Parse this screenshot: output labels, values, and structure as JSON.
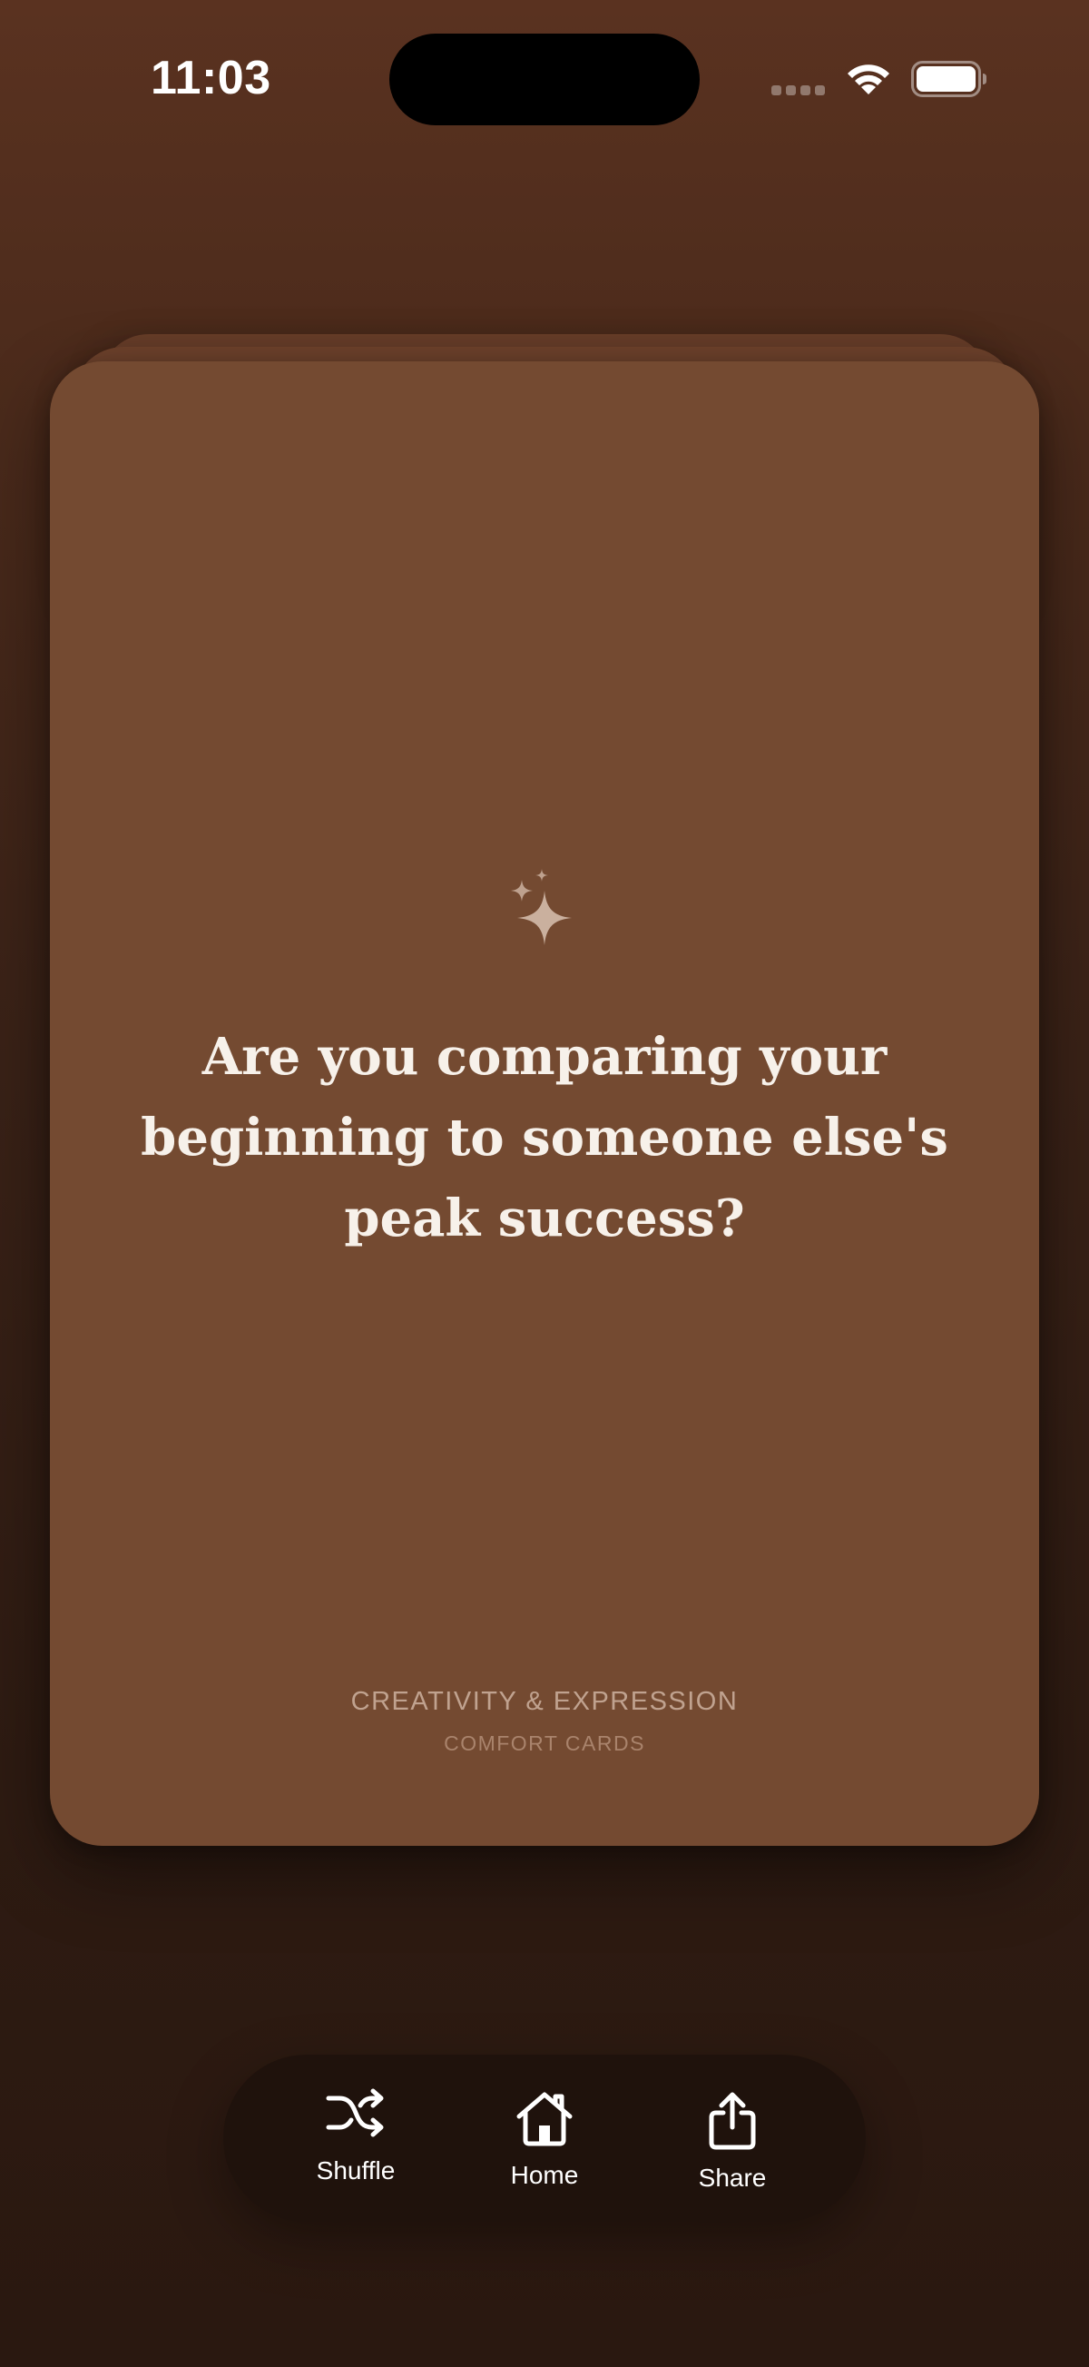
{
  "status_bar": {
    "time": "11:03",
    "icons": [
      "signal-icon",
      "wifi-icon",
      "battery-icon"
    ]
  },
  "card": {
    "icon": "sparkles-icon",
    "question": "Are you comparing your beginning to someone else's peak success?",
    "category": "CREATIVITY & EXPRESSION",
    "brand": "COMFORT CARDS"
  },
  "toolbar": {
    "items": [
      {
        "label": "Shuffle",
        "icon": "shuffle-icon"
      },
      {
        "label": "Home",
        "icon": "home-icon"
      },
      {
        "label": "Share",
        "icon": "share-icon"
      }
    ]
  },
  "colors": {
    "background_top": "#5a3220",
    "background_bottom": "#2a1810",
    "card": "#744a31",
    "toolbar": "#1f120c",
    "text": "#f7f1ea"
  }
}
